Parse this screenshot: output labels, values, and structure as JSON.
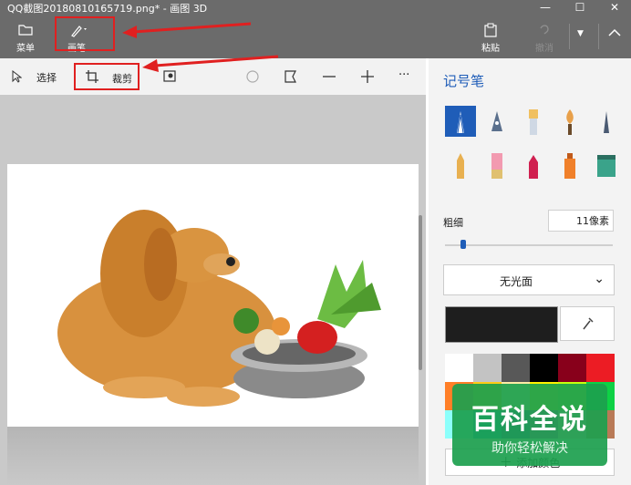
{
  "window": {
    "title": "QQ截图20180810165719.png* - 画图 3D",
    "controls": [
      "—",
      "☐",
      "✕"
    ]
  },
  "ribbon": {
    "menu_label": "菜单",
    "brush_label": "画笔",
    "paste_label": "粘贴",
    "undo_label": "撤消"
  },
  "toolbar": {
    "select_label": "选择",
    "crop_label": "裁剪",
    "more": "···"
  },
  "panel": {
    "title": "记号笔",
    "brushes": [
      "marker",
      "calligraphy-pen",
      "oil-brush",
      "watercolor",
      "pencil",
      "crayon",
      "pixel-pen",
      "spray-can",
      "fill-bucket"
    ],
    "thickness_label": "粗细",
    "thickness_value": "11像素",
    "thickness_fraction": 0.11,
    "finish_value": "无光面",
    "current_color": "#1e1e1e",
    "add_color_label": "添加颜色",
    "palette": [
      "#ffffff",
      "#c3c3c3",
      "#585858",
      "#000000",
      "#88001b",
      "#ec1c24",
      "#ff7f27",
      "#ffca18",
      "#fdeca6",
      "#fff200",
      "#c4ff0e",
      "#0ed145",
      "#8cfffb",
      "#00a8f3",
      "#3f48cc",
      "#b83dba",
      "#ffaec8",
      "#b97a57"
    ]
  },
  "watermark": {
    "title": "百科全说",
    "subtitle": "助你轻松解决"
  },
  "colors": {
    "chrome": "#6b6b6b",
    "accent": "#1f5db8",
    "annotation": "#e02020"
  }
}
